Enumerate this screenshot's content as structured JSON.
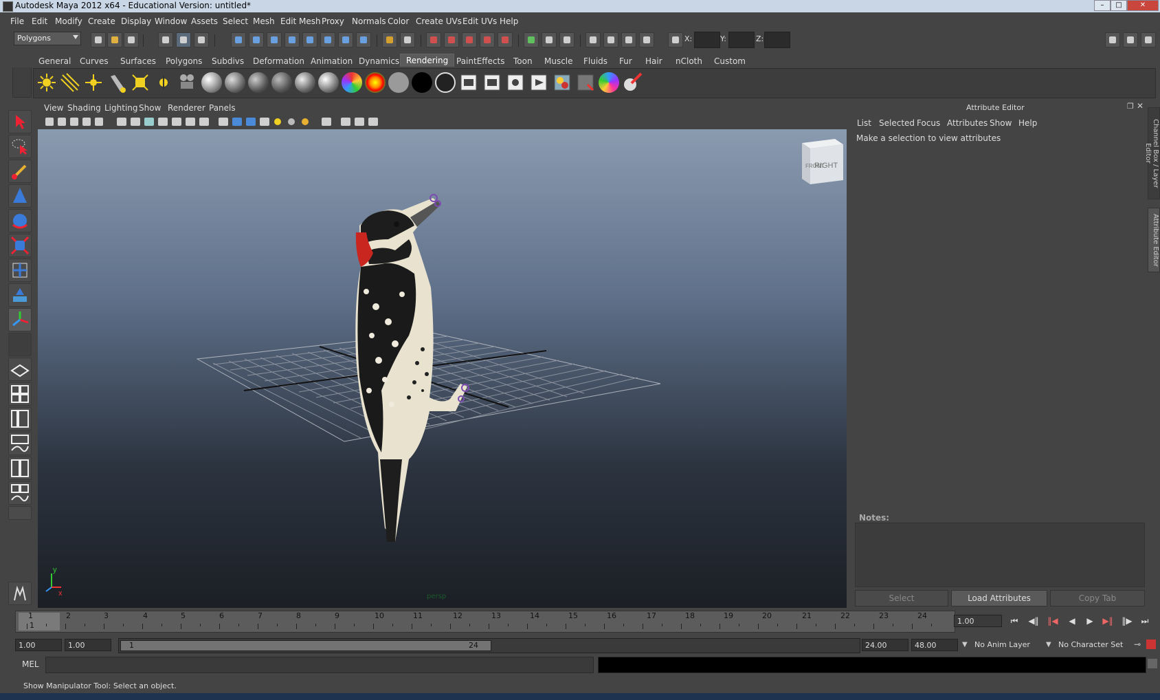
{
  "window": {
    "title": "Autodesk Maya 2012 x64 - Educational Version: untitled*"
  },
  "menubar": [
    "File",
    "Edit",
    "Modify",
    "Create",
    "Display",
    "Window",
    "Assets",
    "Select",
    "Mesh",
    "Edit Mesh",
    "Proxy",
    "Normals",
    "Color",
    "Create UVs",
    "Edit UVs",
    "Help"
  ],
  "statusline": {
    "mode": "Polygons",
    "x_label": "X:",
    "y_label": "Y:",
    "z_label": "Z:"
  },
  "shelf": {
    "tabs": [
      "General",
      "Curves",
      "Surfaces",
      "Polygons",
      "Subdivs",
      "Deformation",
      "Animation",
      "Dynamics",
      "Rendering",
      "PaintEffects",
      "Toon",
      "Muscle",
      "Fluids",
      "Fur",
      "Hair",
      "nCloth",
      "Custom"
    ],
    "active_tab": "Rendering"
  },
  "viewport": {
    "menu": [
      "View",
      "Shading",
      "Lighting",
      "Show",
      "Renderer",
      "Panels"
    ],
    "camera_label": "persp",
    "viewcube": {
      "front": "FRONT",
      "right": "RIGHT"
    },
    "axis": {
      "y": "y",
      "x": "x"
    }
  },
  "attribute_editor": {
    "title": "Attribute Editor",
    "menu": [
      "List",
      "Selected",
      "Focus",
      "Attributes",
      "Show",
      "Help"
    ],
    "message": "Make a selection to view attributes",
    "notes_label": "Notes:",
    "buttons": {
      "select": "Select",
      "load": "Load Attributes",
      "copy": "Copy Tab"
    },
    "side_tabs": [
      "Channel Box / Layer Editor",
      "Attribute Editor"
    ]
  },
  "timeline": {
    "ticks": [
      "1",
      "2",
      "3",
      "4",
      "5",
      "6",
      "7",
      "8",
      "9",
      "10",
      "11",
      "12",
      "13",
      "14",
      "15",
      "16",
      "17",
      "18",
      "19",
      "20",
      "21",
      "22",
      "23",
      "24"
    ],
    "current_marker": "1",
    "current_frame": "1.00"
  },
  "range": {
    "start": "1.00",
    "anim_start": "1.00",
    "slider_start": "1",
    "slider_end": "24",
    "end": "24.00",
    "anim_end": "48.00",
    "anim_layer": "No Anim Layer",
    "character_set": "No Character Set"
  },
  "command_line": {
    "label": "MEL"
  },
  "help_line": "Show Manipulator Tool: Select an object.",
  "colors": {
    "bg": "#444444",
    "viewport_top": "#8a9bb0",
    "viewport_bottom": "#1b1f25",
    "titlebar": "#c9d6e6"
  }
}
